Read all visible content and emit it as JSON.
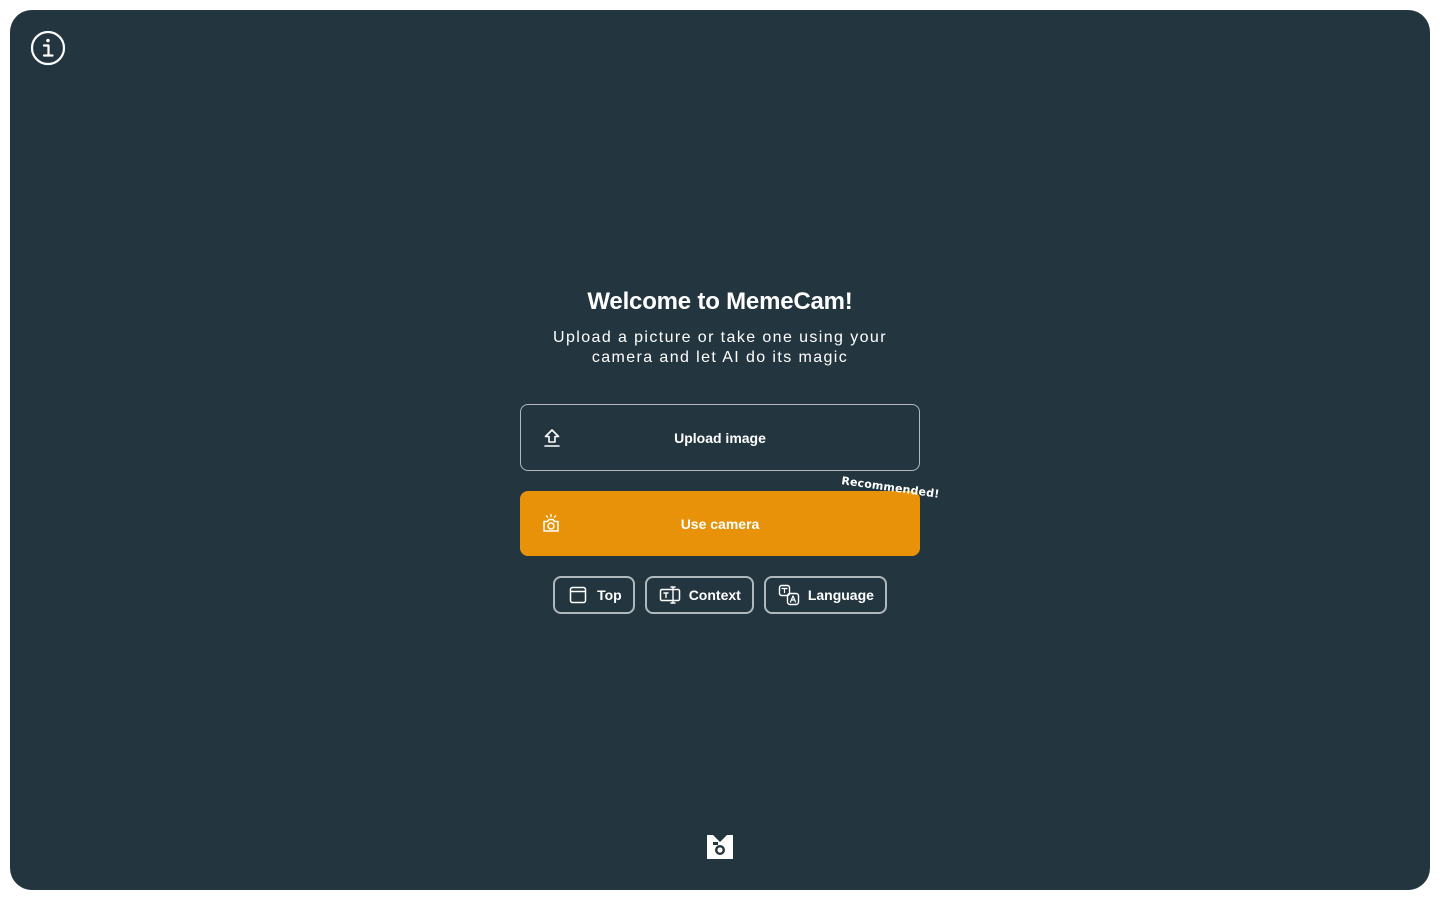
{
  "header": {
    "info_icon": "info-icon"
  },
  "welcome": {
    "title": "Welcome to MemeCam!",
    "subtitle": "Upload a picture or take one using your camera and let AI do its magic"
  },
  "actions": {
    "upload_label": "Upload image",
    "upload_icon": "upload-icon",
    "camera_label": "Use camera",
    "camera_icon": "camera-icon",
    "camera_badge": "Recommended!",
    "accent_color": "#e8920a"
  },
  "options": [
    {
      "label": "Top",
      "icon": "frame-icon"
    },
    {
      "label": "Context",
      "icon": "text-box-icon"
    },
    {
      "label": "Language",
      "icon": "translate-icon"
    }
  ],
  "footer": {
    "logo": "memecam-logo"
  },
  "theme": {
    "background": "#233640",
    "text": "#ffffff",
    "border": "#aeb8bd"
  }
}
